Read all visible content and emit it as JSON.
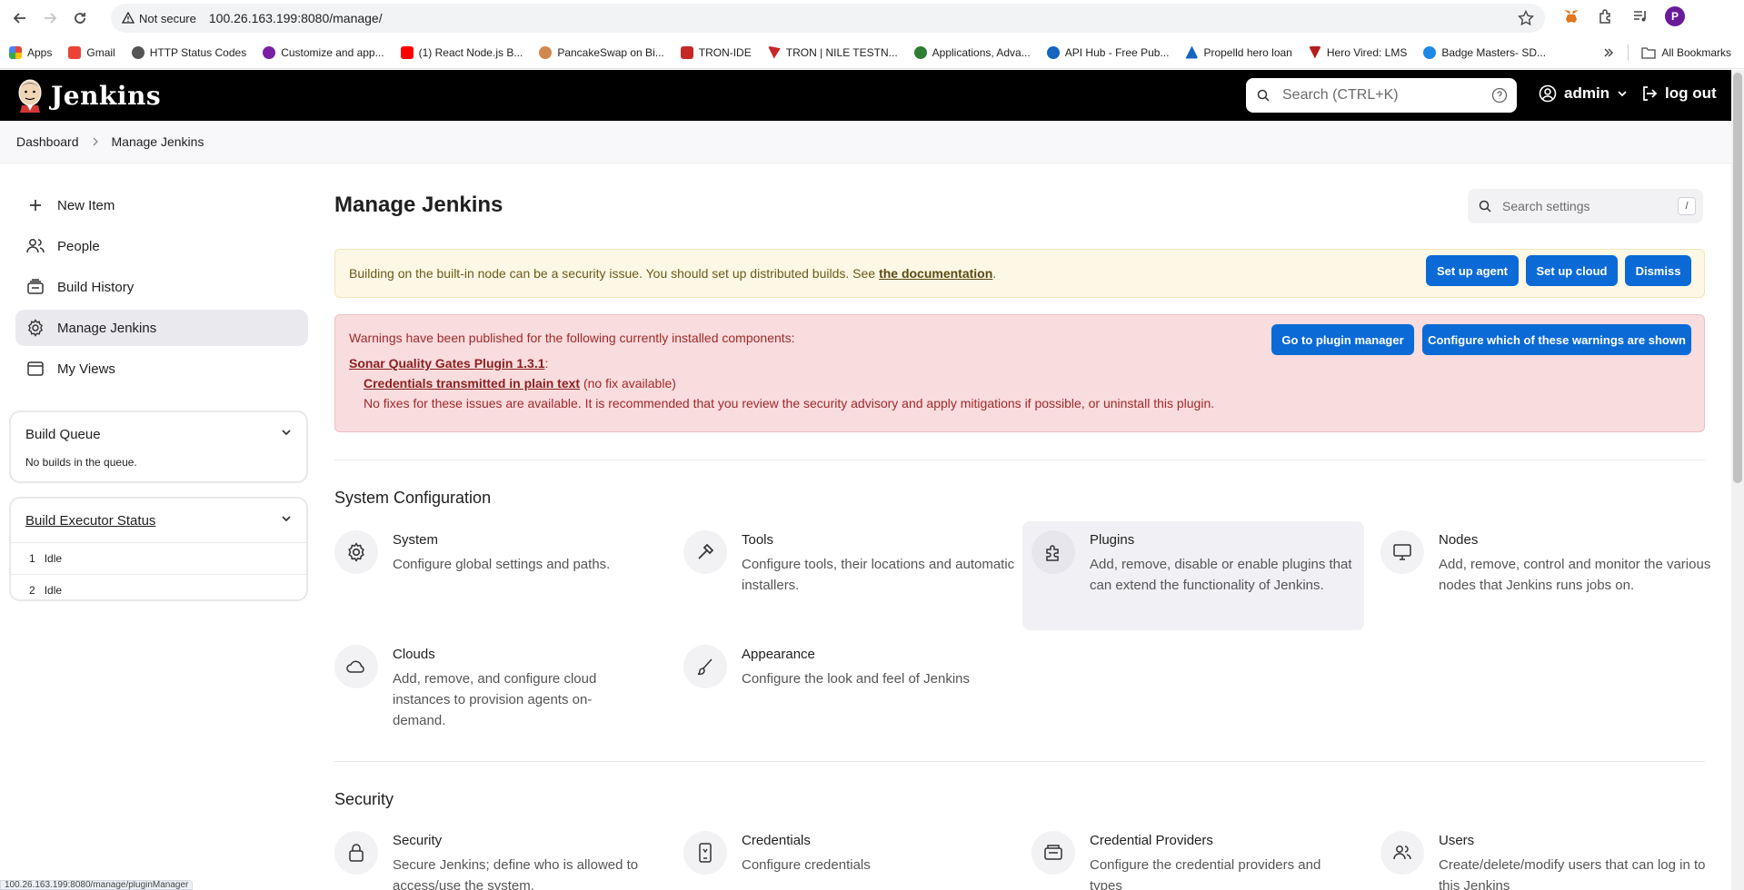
{
  "browser": {
    "security_label": "Not secure",
    "url": "100.26.163.199:8080/manage/",
    "profile_initial": "P",
    "bookmarks": [
      {
        "label": "Apps",
        "color": "#4285f4"
      },
      {
        "label": "Gmail",
        "color": "#ea4335"
      },
      {
        "label": "HTTP Status Codes",
        "color": "#555555"
      },
      {
        "label": "Customize and app...",
        "color": "#7b1fa2"
      },
      {
        "label": "(1) React Node.js B...",
        "color": "#ff0000"
      },
      {
        "label": "PancakeSwap on Bi...",
        "color": "#d1884f"
      },
      {
        "label": "TRON-IDE",
        "color": "#c62828"
      },
      {
        "label": "TRON | NILE TESTN...",
        "color": "#c62828"
      },
      {
        "label": "Applications, Adva...",
        "color": "#2e7d32"
      },
      {
        "label": "API Hub - Free Pub...",
        "color": "#1565c0"
      },
      {
        "label": "Propelld hero loan",
        "color": "#1565c0"
      },
      {
        "label": "Hero Vired: LMS",
        "color": "#b71c1c"
      },
      {
        "label": "Badge Masters- SD...",
        "color": "#1e88e5"
      }
    ],
    "all_bookmarks": "All Bookmarks",
    "status_url": "100.26.163.199:8080/manage/pluginManager"
  },
  "header": {
    "title": "Jenkins",
    "search_placeholder": "Search (CTRL+K)",
    "user": "admin",
    "logout": "log out"
  },
  "breadcrumb": [
    "Dashboard",
    "Manage Jenkins"
  ],
  "sidebar": {
    "items": [
      {
        "label": "New Item",
        "icon": "plus-icon"
      },
      {
        "label": "People",
        "icon": "people-icon"
      },
      {
        "label": "Build History",
        "icon": "history-icon"
      },
      {
        "label": "Manage Jenkins",
        "icon": "gear-icon"
      },
      {
        "label": "My Views",
        "icon": "window-icon"
      }
    ],
    "build_queue": {
      "title": "Build Queue",
      "empty": "No builds in the queue."
    },
    "executors": {
      "title": "Build Executor Status",
      "rows": [
        {
          "num": "1",
          "state": "Idle"
        },
        {
          "num": "2",
          "state": "Idle"
        }
      ]
    }
  },
  "main": {
    "title": "Manage Jenkins",
    "settings_search_placeholder": "Search settings",
    "settings_search_key": "/",
    "builtin_warning": {
      "text": "Building on the built-in node can be a security issue. You should set up distributed builds. See",
      "link": "the documentation",
      "suffix": ".",
      "buttons": [
        "Set up agent",
        "Set up cloud",
        "Dismiss"
      ]
    },
    "plugin_warning": {
      "intro": "Warnings have been published for the following currently installed components:",
      "plugin": "Sonar Quality Gates Plugin 1.3.1",
      "plugin_suffix": ":",
      "issue": "Credentials transmitted in plain text",
      "issue_suffix": "(no fix available)",
      "note": "No fixes for these issues are available. It is recommended that you review the security advisory and apply mitigations if possible, or uninstall this plugin.",
      "buttons": [
        "Go to plugin manager",
        "Configure which of these warnings are shown"
      ]
    },
    "sections": [
      {
        "title": "System Configuration",
        "cards": [
          {
            "title": "System",
            "desc": "Configure global settings and paths.",
            "icon": "gear-icon"
          },
          {
            "title": "Tools",
            "desc": "Configure tools, their locations and automatic installers.",
            "icon": "hammer-icon"
          },
          {
            "title": "Plugins",
            "desc": "Add, remove, disable or enable plugins that can extend the functionality of Jenkins.",
            "icon": "puzzle-icon"
          },
          {
            "title": "Nodes",
            "desc": "Add, remove, control and monitor the various nodes that Jenkins runs jobs on.",
            "icon": "monitor-icon"
          },
          {
            "title": "Clouds",
            "desc": "Add, remove, and configure cloud instances to provision agents on-demand.",
            "icon": "cloud-icon"
          },
          {
            "title": "Appearance",
            "desc": "Configure the look and feel of Jenkins",
            "icon": "brush-icon"
          }
        ]
      },
      {
        "title": "Security",
        "cards": [
          {
            "title": "Security",
            "desc": "Secure Jenkins; define who is allowed to access/use the system.",
            "icon": "lock-icon"
          },
          {
            "title": "Credentials",
            "desc": "Configure credentials",
            "icon": "phone-icon"
          },
          {
            "title": "Credential Providers",
            "desc": "Configure the credential providers and types",
            "icon": "safe-icon"
          },
          {
            "title": "Users",
            "desc": "Create/delete/modify users that can log in to this Jenkins",
            "icon": "users-icon"
          }
        ]
      }
    ]
  }
}
